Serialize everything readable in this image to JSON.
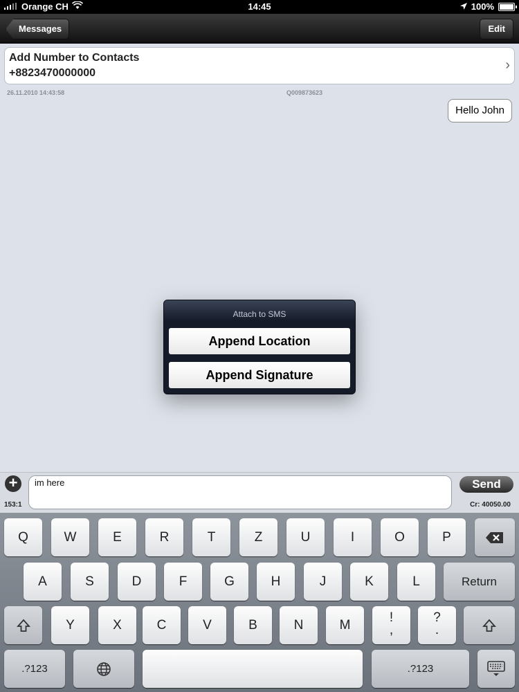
{
  "status_bar": {
    "carrier": "Orange CH",
    "time": "14:45",
    "battery": "100%",
    "battery_level": 1.0
  },
  "nav": {
    "back_label": "Messages",
    "edit_label": "Edit"
  },
  "contact": {
    "line1": "Add Number to Contacts",
    "line2": "+8823470000000"
  },
  "message_meta": {
    "timestamp": "26.11.2010 14:43:58",
    "id": "Q009873623"
  },
  "message": {
    "text": "Hello John"
  },
  "popup": {
    "title": "Attach to SMS",
    "button1": "Append Location",
    "button2": "Append Signature"
  },
  "composer": {
    "counter": "153:1",
    "input_value": "im here",
    "send_label": "Send",
    "credit": "Cr: 40050.00"
  },
  "keyboard": {
    "row1": [
      "Q",
      "W",
      "E",
      "R",
      "T",
      "Z",
      "U",
      "I",
      "O",
      "P"
    ],
    "row2": [
      "A",
      "S",
      "D",
      "F",
      "G",
      "H",
      "J",
      "K",
      "L"
    ],
    "row3": [
      "Y",
      "X",
      "C",
      "V",
      "B",
      "N",
      "M"
    ],
    "return_label": "Return",
    "numbers_label": ".?123",
    "punct1_top": "!",
    "punct1_bottom": ",",
    "punct2_top": "?",
    "punct2_bottom": "."
  }
}
